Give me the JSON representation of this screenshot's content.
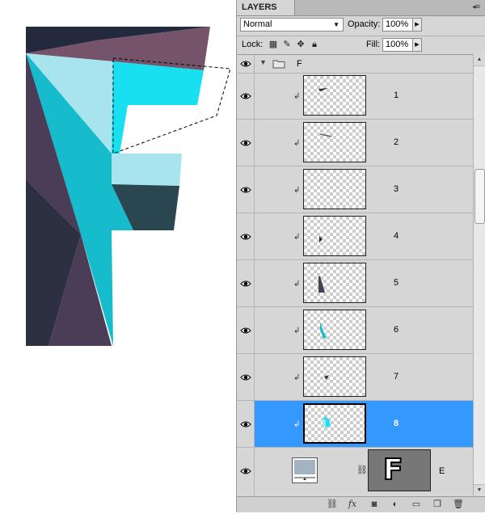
{
  "panel": {
    "title": "LAYERS",
    "menu_icon": "panel-menu-icon",
    "blend_mode": "Normal",
    "opacity_label": "Opacity:",
    "opacity_value": "100%",
    "lock_label": "Lock:",
    "fill_label": "Fill:",
    "fill_value": "100%"
  },
  "group": {
    "name": "F",
    "icon": "folder-icon"
  },
  "layers": [
    {
      "name": "1",
      "selected": false
    },
    {
      "name": "2",
      "selected": false
    },
    {
      "name": "3",
      "selected": false
    },
    {
      "name": "4",
      "selected": false
    },
    {
      "name": "5",
      "selected": false
    },
    {
      "name": "6",
      "selected": false
    },
    {
      "name": "7",
      "selected": false
    },
    {
      "name": "8",
      "selected": true
    }
  ],
  "base_layer": {
    "name": "E",
    "thumb_letter": "F"
  },
  "colors": {
    "selection": "#3399ff",
    "cyan": "#18e0f0",
    "teal": "#17bccc",
    "light_cyan": "#a8e4ee",
    "purple": "#4a3d58",
    "mauve": "#75546b",
    "navy": "#232a3e"
  },
  "bottom_icons": [
    "link-icon",
    "fx-icon",
    "mask-icon",
    "adjustment-icon",
    "group-icon",
    "new-layer-icon",
    "trash-icon"
  ]
}
